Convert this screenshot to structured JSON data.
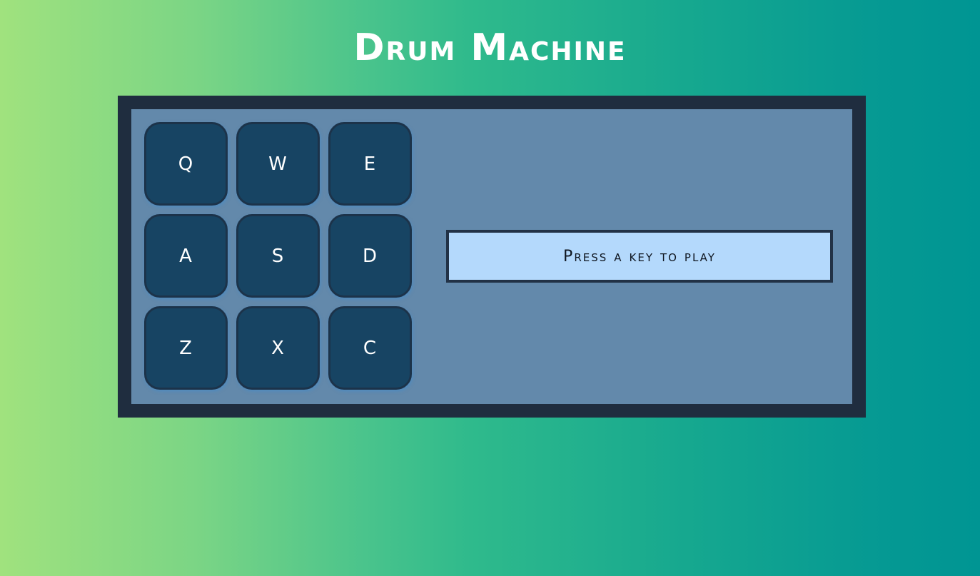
{
  "page": {
    "title": "Drum Machine"
  },
  "pads": [
    {
      "key": "Q"
    },
    {
      "key": "W"
    },
    {
      "key": "E"
    },
    {
      "key": "A"
    },
    {
      "key": "S"
    },
    {
      "key": "D"
    },
    {
      "key": "Z"
    },
    {
      "key": "X"
    },
    {
      "key": "C"
    }
  ],
  "display": {
    "text": "Press a key to play"
  },
  "colors": {
    "background_gradient_start": "#a0e27e",
    "background_gradient_end": "#009593",
    "machine_frame": "#1f2d3f",
    "machine_panel": "#6389ab",
    "pad_fill": "#174463",
    "display_fill": "#b4d9fc",
    "text_light": "#ffffff",
    "text_dark": "#0f1620"
  }
}
